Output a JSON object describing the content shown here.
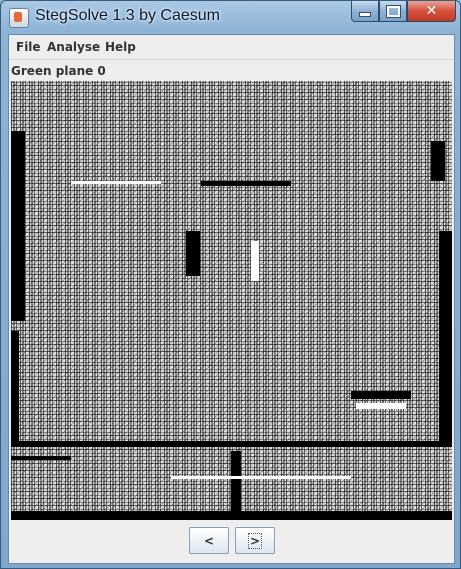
{
  "window": {
    "title": "StegSolve 1.3 by Caesum",
    "controls": {
      "minimize_icon": "minimize-icon",
      "maximize_icon": "maximize-icon",
      "close_label": "✕"
    }
  },
  "menubar": {
    "items": [
      "File",
      "Analyse",
      "Help"
    ]
  },
  "viewer": {
    "plane_label": "Green plane 0",
    "image_description_icon": "bitplane-image"
  },
  "navigation": {
    "prev_label": "<",
    "next_label": ">"
  }
}
